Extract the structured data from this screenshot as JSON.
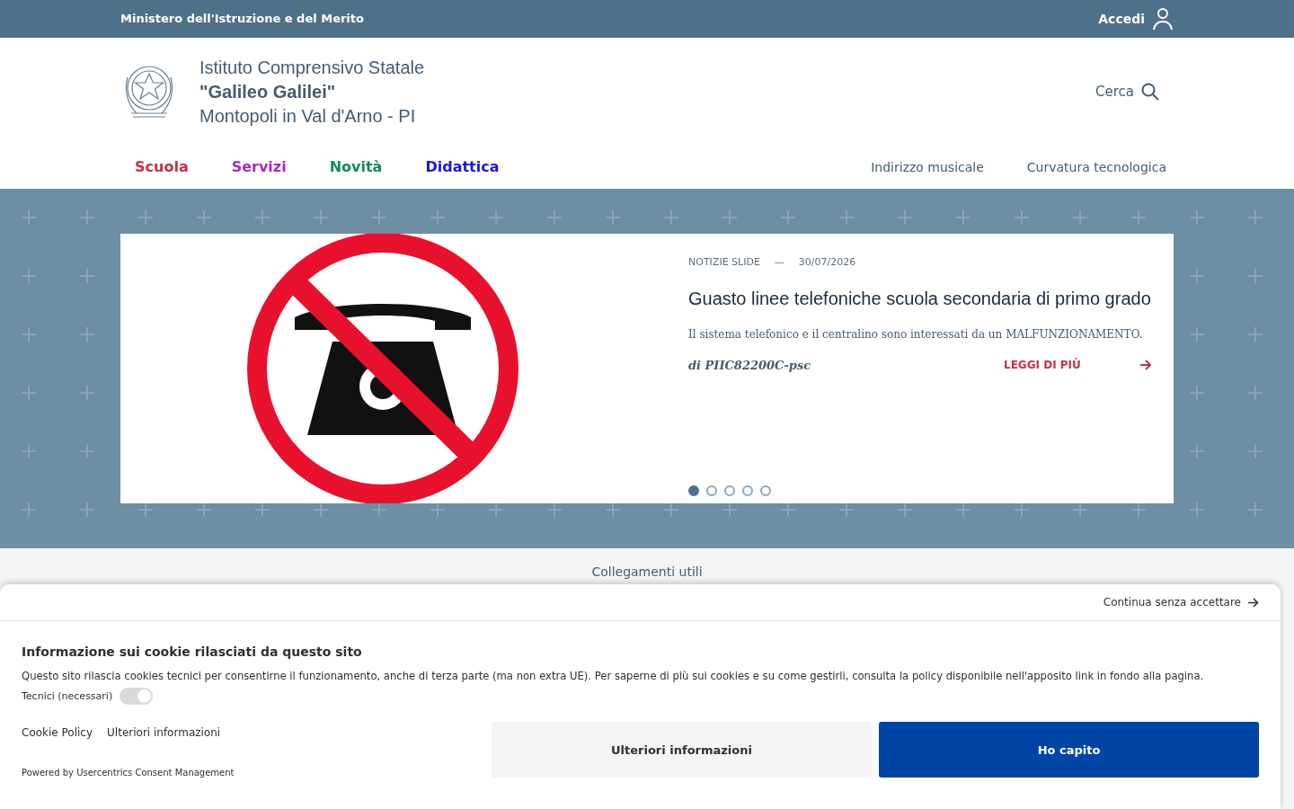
{
  "top_bar": {
    "ministry": "Ministero dell'Istruzione e del Merito",
    "login": "Accedi"
  },
  "header": {
    "title_line_1": "Istituto Comprensivo Statale",
    "title_line_2": "\"Galileo Galilei\"",
    "title_line_3": "Montopoli in Val d'Arno - PI",
    "search": "Cerca"
  },
  "main_nav": [
    {
      "label": "Scuola",
      "color": "#c4304a"
    },
    {
      "label": "Servizi",
      "color": "#a829bf"
    },
    {
      "label": "Novità",
      "color": "#168a5a"
    },
    {
      "label": "Didattica",
      "color": "#1f16d8"
    }
  ],
  "secondary_nav": [
    "Indirizzo musicale",
    "Curvatura tecnologica"
  ],
  "slide": {
    "kind": "picture",
    "category": "NOTIZIE SLIDE",
    "separator": "—",
    "date": "30/07/2026",
    "title": "Guasto linee telefoniche scuola secondaria di primo grado",
    "summary": "Il sistema telefonico e il centralino sono interessati da un MALFUNZIONAMENTO.",
    "author": "di PIIC82200C-psc",
    "read_more": "LEGGI DI PIÙ"
  },
  "carousel_indicators": [
    {
      "selected": true
    },
    {
      "selected": false
    },
    {
      "selected": false
    },
    {
      "selected": false
    },
    {
      "selected": false
    }
  ],
  "section_title": "Collegamenti utili",
  "cookie_banner": {
    "skip": "Continua senza accettare",
    "title": "Informazione sui cookie rilasciati da questo sito",
    "text": "Questo sito rilascia cookies tecnici per consentirne il funzionamento, anche di terza parte (ma non extra UE). Per saperne di più sui cookies e su come gestirli, consulta la policy disponibile nell'apposito link in fondo alla pagina.",
    "toggle": {
      "label": "Tecnici (necessari)",
      "checked": true,
      "disabled": true
    },
    "links": [
      "Cookie Policy",
      "Ulteriori informazioni"
    ],
    "powered_by": "Powered by Usercentrics Consent Management",
    "buttons": [
      "Ulteriori informazioni",
      "Ho capito"
    ]
  }
}
